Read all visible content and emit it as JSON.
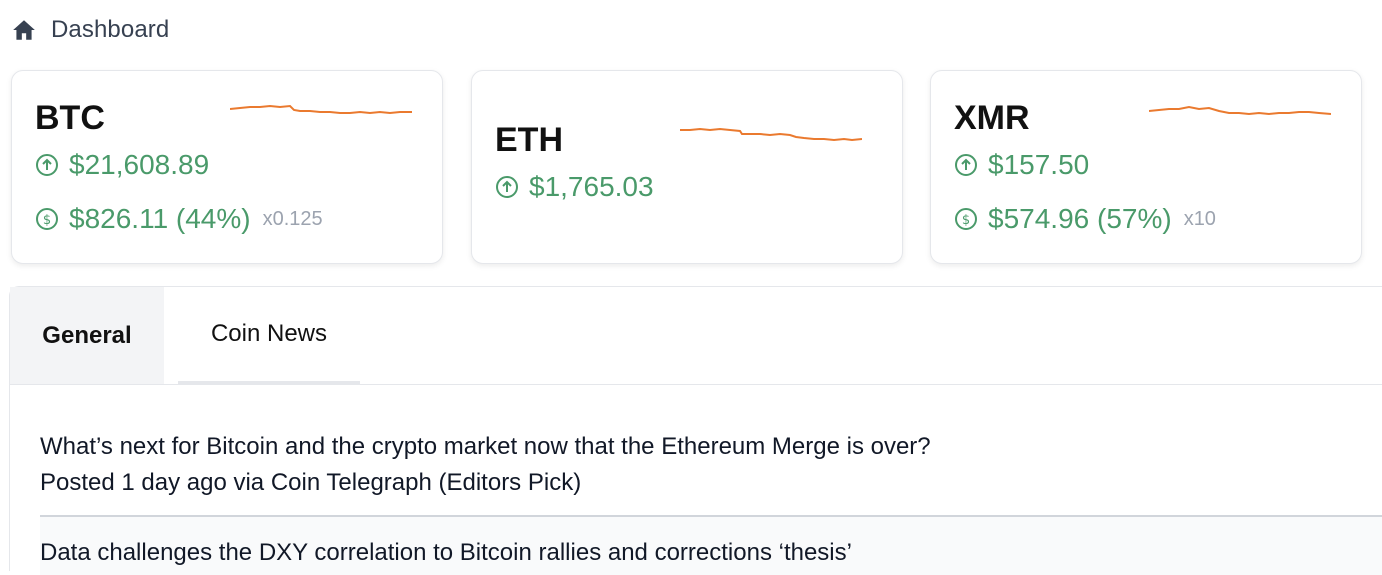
{
  "breadcrumb": {
    "title": "Dashboard",
    "icon": "home-icon"
  },
  "colors": {
    "gain": "#4a9a6a",
    "sparkline": "#ea7a2f",
    "muted": "#9ca3af"
  },
  "cards": [
    {
      "symbol": "BTC",
      "price": "$21,608.89",
      "price_icon": "arrow-up-circle-icon",
      "holding": "$826.11 (44%)",
      "holding_icon": "dollar-circle-icon",
      "multiplier": "x0.125"
    },
    {
      "symbol": "ETH",
      "price": "$1,765.03",
      "price_icon": "arrow-up-circle-icon"
    },
    {
      "symbol": "XMR",
      "price": "$157.50",
      "price_icon": "arrow-up-circle-icon",
      "holding": "$574.96 (57%)",
      "holding_icon": "dollar-circle-icon",
      "multiplier": "x10"
    }
  ],
  "tabs": [
    {
      "label": "General",
      "active": true
    },
    {
      "label": "Coin News",
      "active": false
    }
  ],
  "news": [
    {
      "headline": "What’s next for Bitcoin and the crypto market now that the Ethereum Merge is over?",
      "meta": "Posted 1 day ago via Coin Telegraph (Editors Pick)"
    },
    {
      "headline": "Data challenges the DXY correlation to Bitcoin rallies and corrections ‘thesis’"
    }
  ]
}
